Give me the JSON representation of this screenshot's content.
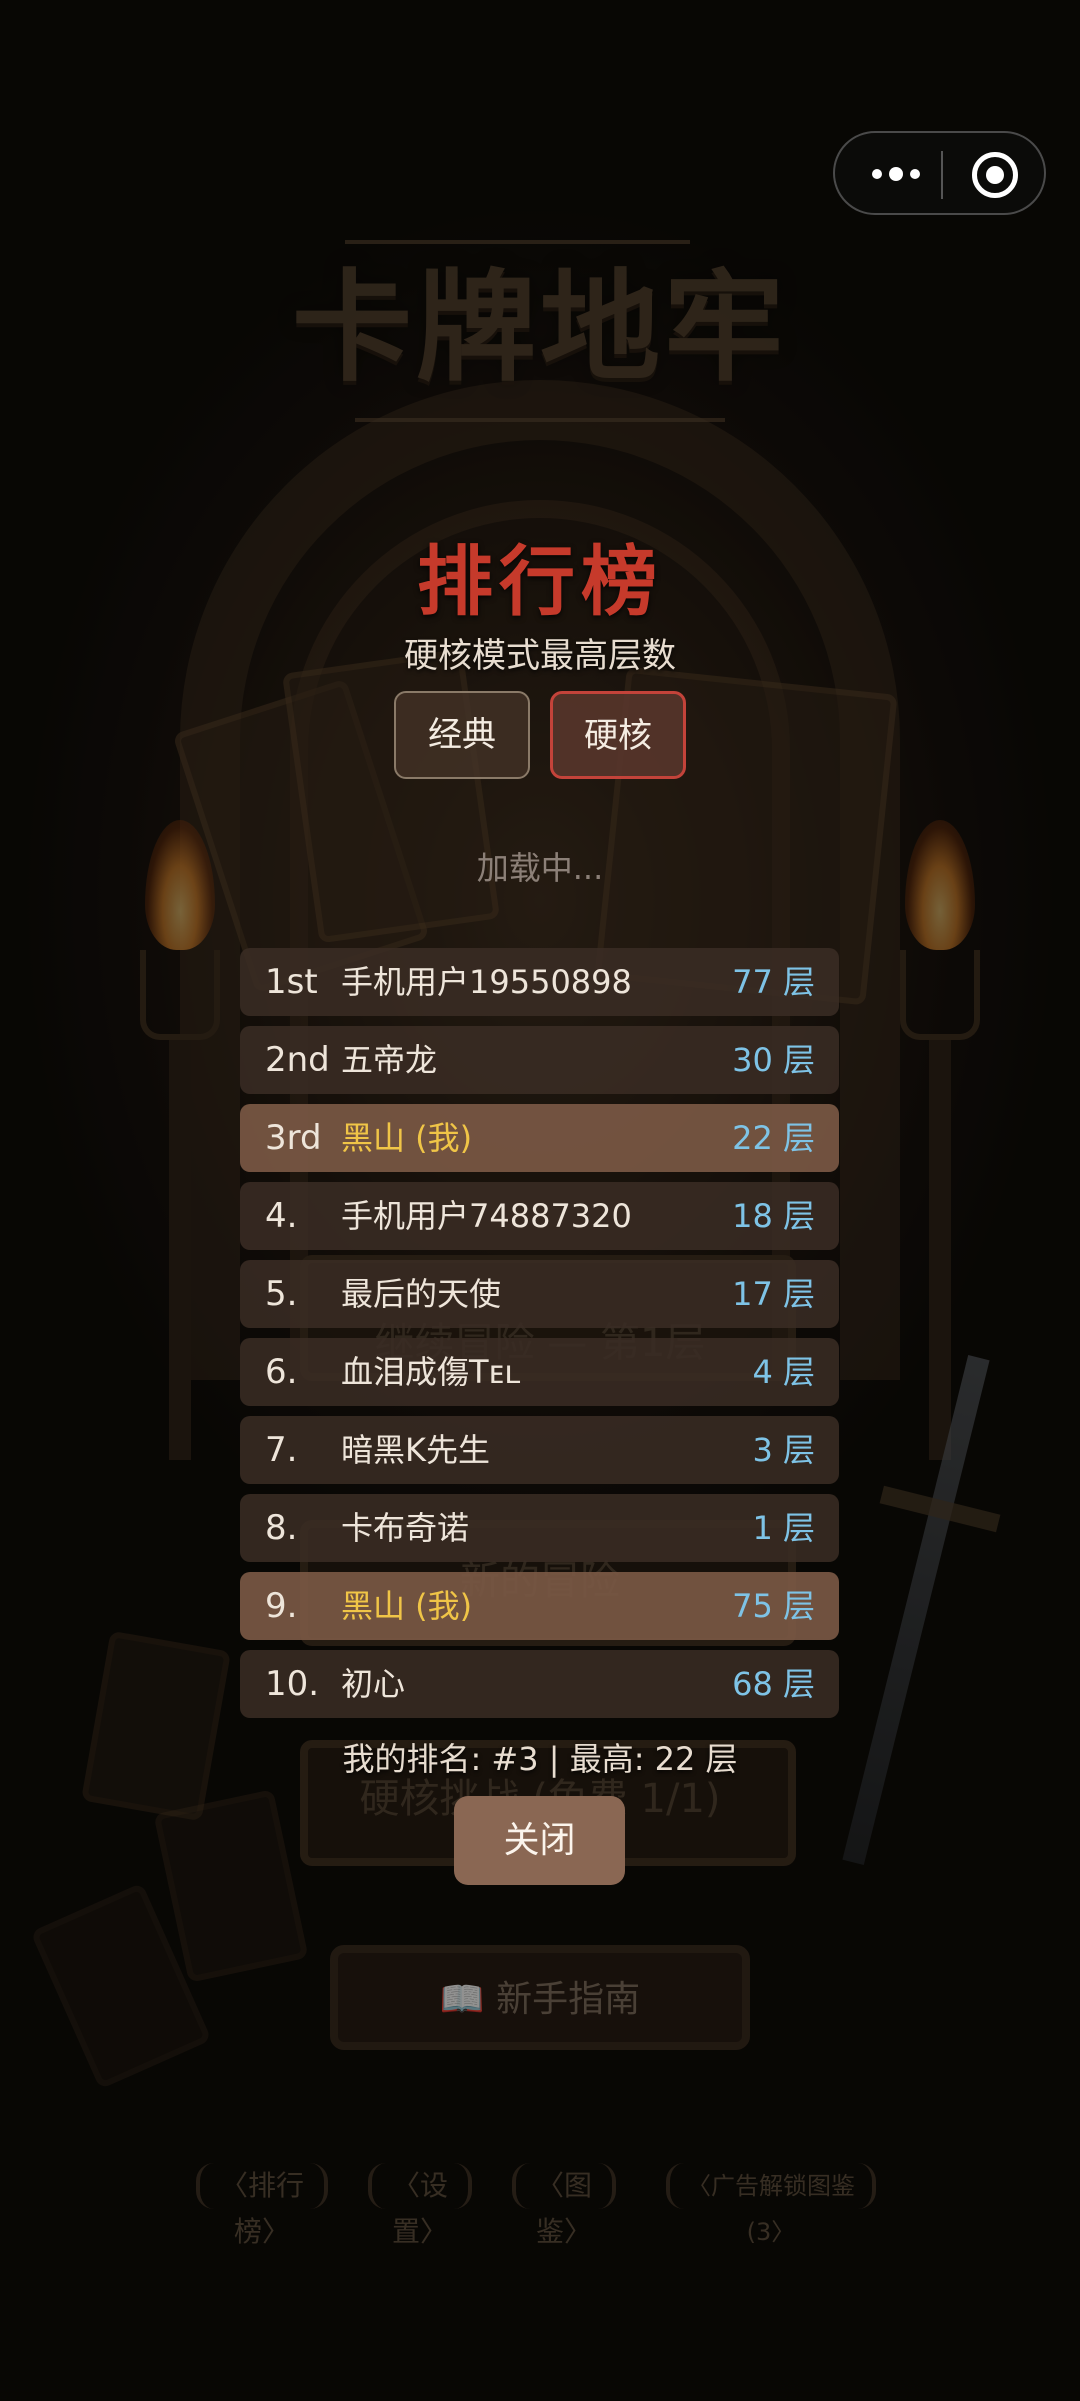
{
  "game_title": "卡牌地牢",
  "background_menu": {
    "continue_label": "继续冒险 — 第1层",
    "new_adventure_label": "新的冒险",
    "hardcore_label": "硬核挑战 (免费 1/1)",
    "guide_label": "📖 新手指南",
    "bottom_links": [
      "〈排行榜〉",
      "〈设置〉",
      "〈图鉴〉",
      "〈广告解锁图鉴(3〉"
    ]
  },
  "leaderboard": {
    "title": "排行榜",
    "subtitle": "硬核模式最高层数",
    "tabs": [
      {
        "label": "经典",
        "active": false
      },
      {
        "label": "硬核",
        "active": true
      }
    ],
    "loading_text": "加载中...",
    "rows": [
      {
        "pos": "1st",
        "name": "手机用户19550898",
        "floors": "77 层",
        "is_me": false
      },
      {
        "pos": "2nd",
        "name": "五帝龙",
        "floors": "30 层",
        "is_me": false
      },
      {
        "pos": "3rd",
        "name": "黑山 (我)",
        "floors": "22 层",
        "is_me": true
      },
      {
        "pos": "4.",
        "name": "手机用户74887320",
        "floors": "18 层",
        "is_me": false
      },
      {
        "pos": "5.",
        "name": "最后的天使",
        "floors": "17 层",
        "is_me": false
      },
      {
        "pos": "6.",
        "name": "血泪成傷Tᴇʟ",
        "floors": "4 层",
        "is_me": false
      },
      {
        "pos": "7.",
        "name": "暗黑K先生",
        "floors": "3 层",
        "is_me": false
      },
      {
        "pos": "8.",
        "name": "卡布奇诺",
        "floors": "1 层",
        "is_me": false
      },
      {
        "pos": "9.",
        "name": "黑山 (我)",
        "floors": "75 层",
        "is_me": true
      },
      {
        "pos": "10.",
        "name": "初心",
        "floors": "68 层",
        "is_me": false
      }
    ],
    "my_rank_text": "我的排名: #3 | 最高: 22 层",
    "close_label": "关闭"
  },
  "colors": {
    "title_red": "#c63a2b",
    "highlight_gold": "#f0c547",
    "floor_blue": "#7ec3e6",
    "active_tab_border": "#c3433a"
  }
}
